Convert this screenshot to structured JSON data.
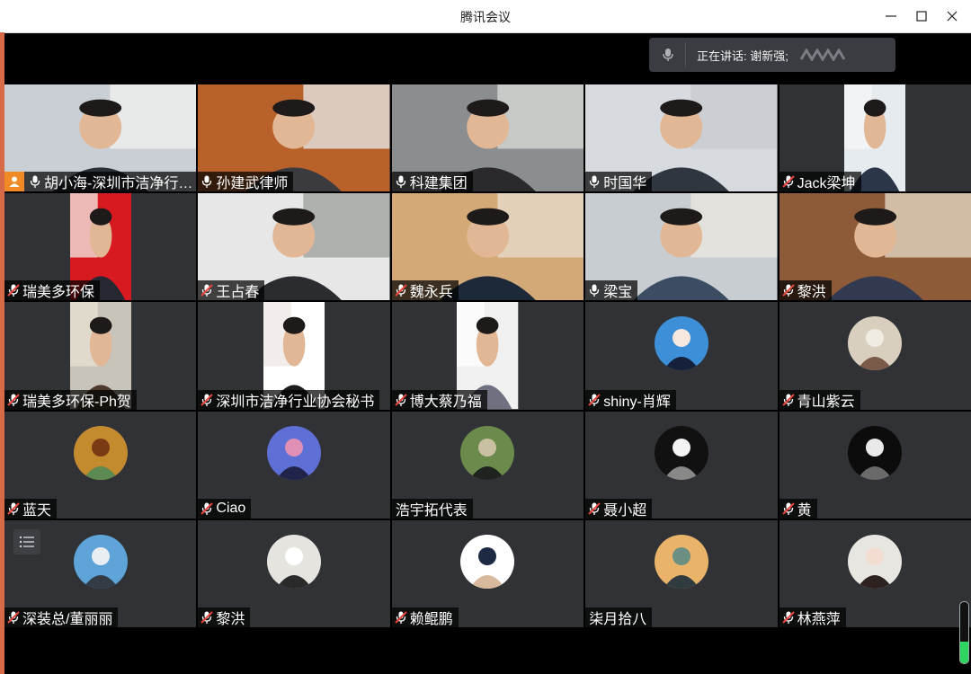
{
  "window": {
    "title": "腾讯会议"
  },
  "speaking": {
    "label": "正在讲话: 谢新强;"
  },
  "volume_level": 0.35,
  "participants": [
    {
      "name": "胡小海-深圳市洁净行业协会",
      "mic": "on",
      "host": true,
      "video": "full",
      "palette": [
        "#c9cfd4",
        "#f2f2f0",
        "#2b2f38"
      ]
    },
    {
      "name": "孙建武律师",
      "mic": "on",
      "video": "full",
      "palette": [
        "#b8612a",
        "#e9eef1",
        "#3b3a3e"
      ]
    },
    {
      "name": "科建集团",
      "mic": "on",
      "video": "full",
      "palette": [
        "#8b8e90",
        "#d9dcd8",
        "#2a2a2d"
      ]
    },
    {
      "name": "时国华",
      "mic": "on",
      "video": "full",
      "palette": [
        "#d7dbe0",
        "#c7cacf",
        "#2f3640"
      ]
    },
    {
      "name": "Jack梁坤",
      "mic": "muted",
      "video": "portrait",
      "palette": [
        "#e6ebef",
        "#f5f5f5",
        "#2b3648"
      ]
    },
    {
      "name": "瑞美多环保",
      "mic": "muted",
      "video": "portrait",
      "palette": [
        "#d71a1f",
        "#f4efe9",
        "#252831"
      ]
    },
    {
      "name": "王占春",
      "mic": "muted",
      "video": "full",
      "palette": [
        "#e6e7e6",
        "#9a9d9a",
        "#2a2c30"
      ]
    },
    {
      "name": "魏永兵",
      "mic": "muted",
      "video": "full",
      "palette": [
        "#d2a977",
        "#e7ddcf",
        "#1d2838"
      ]
    },
    {
      "name": "梁宝",
      "mic": "on",
      "video": "full",
      "palette": [
        "#c8cdd2",
        "#ebe7de",
        "#3c4c62"
      ]
    },
    {
      "name": "黎洪",
      "mic": "muted",
      "video": "full",
      "palette": [
        "#8d5b37",
        "#e8dccb",
        "#323a52"
      ]
    },
    {
      "name": "瑞美多环保-Ph贺",
      "mic": "muted",
      "video": "portrait",
      "palette": [
        "#c9c4ba",
        "#e7e1d2",
        "#4a3b2c"
      ]
    },
    {
      "name": "深圳市洁净行业协会秘书",
      "mic": "muted",
      "video": "portrait",
      "palette": [
        "#ffffff",
        "#ede7e3",
        "#1c1c1c"
      ]
    },
    {
      "name": "博大蔡乃福",
      "mic": "muted",
      "video": "portrait",
      "palette": [
        "#f0f0f0",
        "#ffffff",
        "#6f7180"
      ]
    },
    {
      "name": "shiny-肖辉",
      "mic": "muted",
      "video": "avatar",
      "palette": [
        "#3d8fd8",
        "#f6e8df",
        "#16203a"
      ]
    },
    {
      "name": "青山紫云",
      "mic": "muted",
      "video": "avatar",
      "palette": [
        "#d9cfbf",
        "#f0ece4",
        "#7a5a48"
      ]
    },
    {
      "name": "蓝天",
      "mic": "muted",
      "video": "avatar",
      "palette": [
        "#c48b2e",
        "#7a3a14",
        "#5c8a52"
      ]
    },
    {
      "name": "Ciao",
      "mic": "muted",
      "video": "avatar",
      "palette": [
        "#5e6fd6",
        "#e08fb5",
        "#20244a"
      ]
    },
    {
      "name": "浩宇拓代表",
      "mic": "none",
      "video": "avatar",
      "palette": [
        "#6c8a4c",
        "#c9c0a2",
        "#1f2320"
      ]
    },
    {
      "name": "聂小超",
      "mic": "muted",
      "video": "avatar",
      "palette": [
        "#111111",
        "#f4f4f4",
        "#888888"
      ]
    },
    {
      "name": "黄",
      "mic": "muted",
      "video": "avatar",
      "palette": [
        "#0c0c0c",
        "#e9e9e9",
        "#6a6a6a"
      ]
    },
    {
      "name": "深装总/董丽丽",
      "mic": "muted",
      "video": "avatar",
      "palette": [
        "#5fa4d9",
        "#e8eef2",
        "#333c44"
      ]
    },
    {
      "name": "黎洪",
      "mic": "muted",
      "video": "avatar",
      "palette": [
        "#e6e4df",
        "#ffffff",
        "#2a2a2a"
      ]
    },
    {
      "name": "赖鲲鹏",
      "mic": "muted",
      "video": "avatar",
      "palette": [
        "#ffffff",
        "#1e2a44",
        "#d9b99d"
      ]
    },
    {
      "name": "柒月拾八",
      "mic": "none",
      "video": "avatar",
      "palette": [
        "#e9b36a",
        "#6b8f82",
        "#2f3b3f"
      ]
    },
    {
      "name": "林燕萍",
      "mic": "muted",
      "video": "avatar",
      "palette": [
        "#e8e6e1",
        "#f3dcd0",
        "#2d2220"
      ]
    }
  ],
  "icons": {
    "menu": "list-menu-icon",
    "mic_on": "microphone-icon",
    "mic_muted": "microphone-muted-icon",
    "host": "host-person-icon",
    "minimize": "minimize-icon",
    "maximize": "maximize-icon",
    "close": "close-icon"
  }
}
